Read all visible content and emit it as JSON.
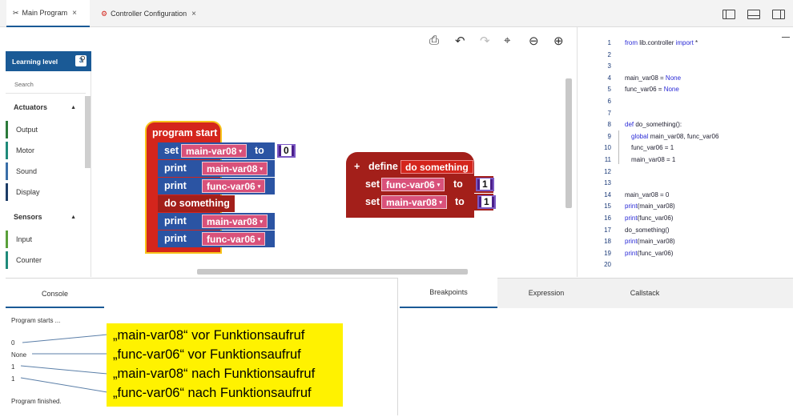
{
  "tabs": {
    "main_icon": "puzzle-icon",
    "main_label": "Main Program",
    "config_icon": "gear-icon",
    "config_label": "Controller Configuration",
    "close_glyph": "×"
  },
  "sidebar": {
    "learning_label": "Learning level",
    "level": "3",
    "search_placeholder": "Search",
    "categories": [
      {
        "label": "Actuators",
        "items": [
          "Output",
          "Motor",
          "Sound",
          "Display"
        ]
      },
      {
        "label": "Sensors",
        "items": [
          "Input",
          "Counter"
        ]
      }
    ]
  },
  "toolbar": [
    "print-icon",
    "undo-icon",
    "redo-icon",
    "center-icon",
    "zoom-out-icon",
    "zoom-in-icon"
  ],
  "blocks": {
    "program_start": "program start",
    "set": "set",
    "to": "to",
    "print": "print",
    "do_something": "do something",
    "define": "define",
    "define_name": "do something",
    "var_main": "main-var08",
    "var_func": "func-var06",
    "zero": "0",
    "one": "1",
    "plus": "+"
  },
  "code": {
    "lines": [
      {
        "n": "1",
        "text": "from lib.controller import *"
      },
      {
        "n": "2",
        "text": ""
      },
      {
        "n": "3",
        "text": ""
      },
      {
        "n": "4",
        "text": "main_var08 = None"
      },
      {
        "n": "5",
        "text": "func_var06 = None"
      },
      {
        "n": "6",
        "text": ""
      },
      {
        "n": "7",
        "text": ""
      },
      {
        "n": "8",
        "text": "def do_something():"
      },
      {
        "n": "9",
        "text": "global main_var08, func_var06"
      },
      {
        "n": "10",
        "text": "func_var06 = 1"
      },
      {
        "n": "11",
        "text": "main_var08 = 1"
      },
      {
        "n": "12",
        "text": ""
      },
      {
        "n": "13",
        "text": ""
      },
      {
        "n": "14",
        "text": "main_var08 = 0"
      },
      {
        "n": "15",
        "text": "print(main_var08)"
      },
      {
        "n": "16",
        "text": "print(func_var06)"
      },
      {
        "n": "17",
        "text": "do_something()"
      },
      {
        "n": "18",
        "text": "print(main_var08)"
      },
      {
        "n": "19",
        "text": "print(func_var06)"
      },
      {
        "n": "20",
        "text": ""
      }
    ]
  },
  "console": {
    "tab": "Console",
    "lines": [
      "Program starts ...",
      "0",
      "None",
      "1",
      "1",
      "Program finished."
    ]
  },
  "debug_tabs": [
    "Breakpoints",
    "Expression",
    "Callstack"
  ],
  "annotation": [
    "„main-var08“ vor Funktionsaufruf",
    "„func-var06“ vor Funktionsaufruf",
    "„main-var08“ nach Funktionsaufruf",
    "„func-var06“ nach Funktionsaufruf"
  ],
  "colors": {
    "accent": "#1a5a96",
    "hat_block": "#d4251c",
    "proc_block": "#a31f1a",
    "variable": "#d9517a",
    "number": "#4b1f8a",
    "annotation_bg": "#fff200"
  }
}
